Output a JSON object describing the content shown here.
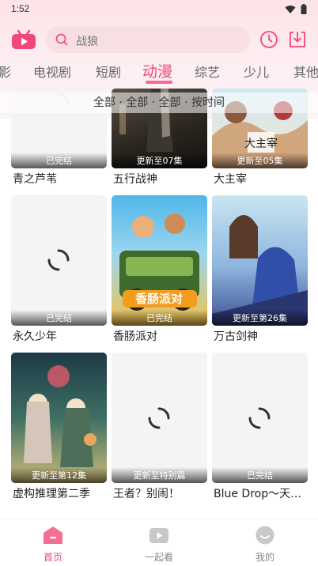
{
  "status": {
    "time": "1:52"
  },
  "search": {
    "placeholder": "战狼"
  },
  "tabs": [
    {
      "label": "影"
    },
    {
      "label": "电视剧"
    },
    {
      "label": "短剧"
    },
    {
      "label": "动漫"
    },
    {
      "label": "综艺"
    },
    {
      "label": "少儿"
    },
    {
      "label": "其他"
    }
  ],
  "active_tab": "动漫",
  "filter": {
    "text": "全部 · 全部 · 全部 · 按时间"
  },
  "cards": [
    {
      "title": "青之芦苇",
      "badge": "已完结"
    },
    {
      "title": "五行战神",
      "badge": "更新至07集"
    },
    {
      "title": "大主宰",
      "badge": "更新至05集"
    },
    {
      "title": "永久少年",
      "badge": "已完结"
    },
    {
      "title": "香肠派对",
      "badge": "已完结"
    },
    {
      "title": "万古剑神",
      "badge": "更新至第26集"
    },
    {
      "title": "虚构推理第二季",
      "badge": "更新至第12集"
    },
    {
      "title": "王者？别闹！",
      "badge": "更新至特别篇"
    },
    {
      "title": "Blue Drop～天…",
      "badge": "已完结"
    }
  ],
  "bottom_nav": [
    {
      "label": "首页"
    },
    {
      "label": "一起看"
    },
    {
      "label": "我的"
    }
  ],
  "colors": {
    "accent": "#f0467a",
    "header_bg": "#fde3e8"
  }
}
